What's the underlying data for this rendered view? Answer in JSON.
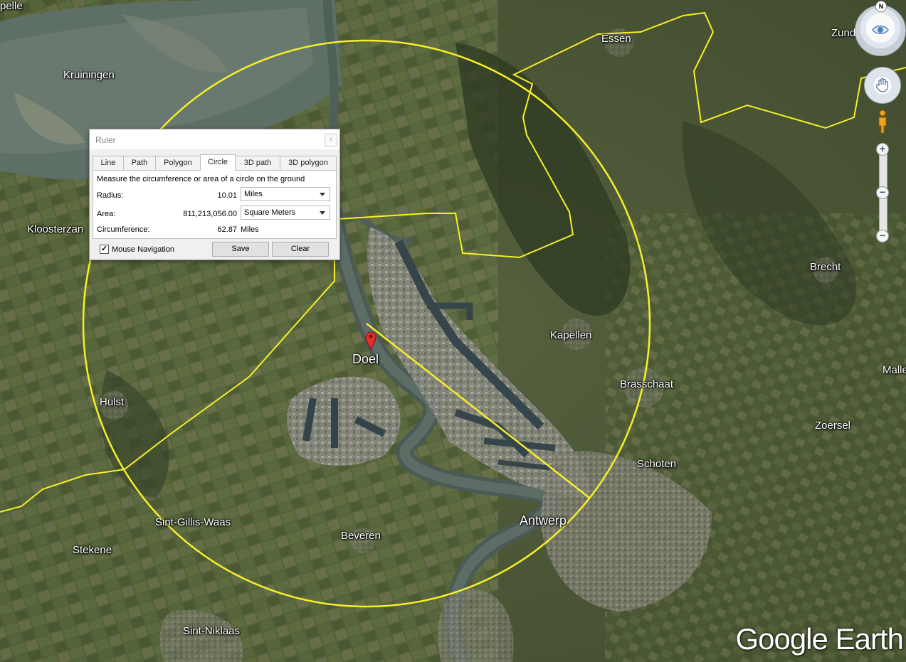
{
  "map": {
    "places": [
      {
        "name": "pelle",
        "id": "place-pelle"
      },
      {
        "name": "Essen",
        "id": "place-essen"
      },
      {
        "name": "Zunde",
        "id": "place-zundert"
      },
      {
        "name": "Kruiningen",
        "id": "place-kruiningen"
      },
      {
        "name": "Kloosterzan",
        "id": "place-kloosterzande"
      },
      {
        "name": "Brecht",
        "id": "place-brecht"
      },
      {
        "name": "Doel",
        "id": "place-doel"
      },
      {
        "name": "Kapellen",
        "id": "place-kapellen"
      },
      {
        "name": "Malle",
        "id": "place-malle"
      },
      {
        "name": "Brasschaat",
        "id": "place-brasschaat"
      },
      {
        "name": "Hulst",
        "id": "place-hulst"
      },
      {
        "name": "Zoersel",
        "id": "place-zoersel"
      },
      {
        "name": "Schoten",
        "id": "place-schoten"
      },
      {
        "name": "Sint-Gillis-Waas",
        "id": "place-sint-gillis-waas"
      },
      {
        "name": "Antwerp",
        "id": "place-antwerp"
      },
      {
        "name": "Beveren",
        "id": "place-beveren"
      },
      {
        "name": "Stekene",
        "id": "place-stekene"
      },
      {
        "name": "Sint-Niklaas",
        "id": "place-sint-niklaas"
      }
    ],
    "measure_circle_color": "#f5ef2a",
    "border_color": "#f5ef2a",
    "watermark": "Google Earth"
  },
  "ruler": {
    "title": "Ruler",
    "close_label": "x",
    "tabs": [
      "Line",
      "Path",
      "Polygon",
      "Circle",
      "3D path",
      "3D polygon"
    ],
    "active_tab": "Circle",
    "description": "Measure the circumference or area of a circle on the ground",
    "radius_label": "Radius:",
    "radius_value": "10.01",
    "radius_unit": "Miles",
    "area_label": "Area:",
    "area_value": "811,213,056.00",
    "area_unit": "Square Meters",
    "circumference_label": "Circumference:",
    "circumference_value": "62.87",
    "circumference_unit": "Miles",
    "mouse_nav_label": "Mouse Navigation",
    "mouse_nav_checked": "✓",
    "save_label": "Save",
    "clear_label": "Clear"
  },
  "nav": {
    "north_label": "N",
    "zoom_in": "+",
    "zoom_out": "−"
  }
}
